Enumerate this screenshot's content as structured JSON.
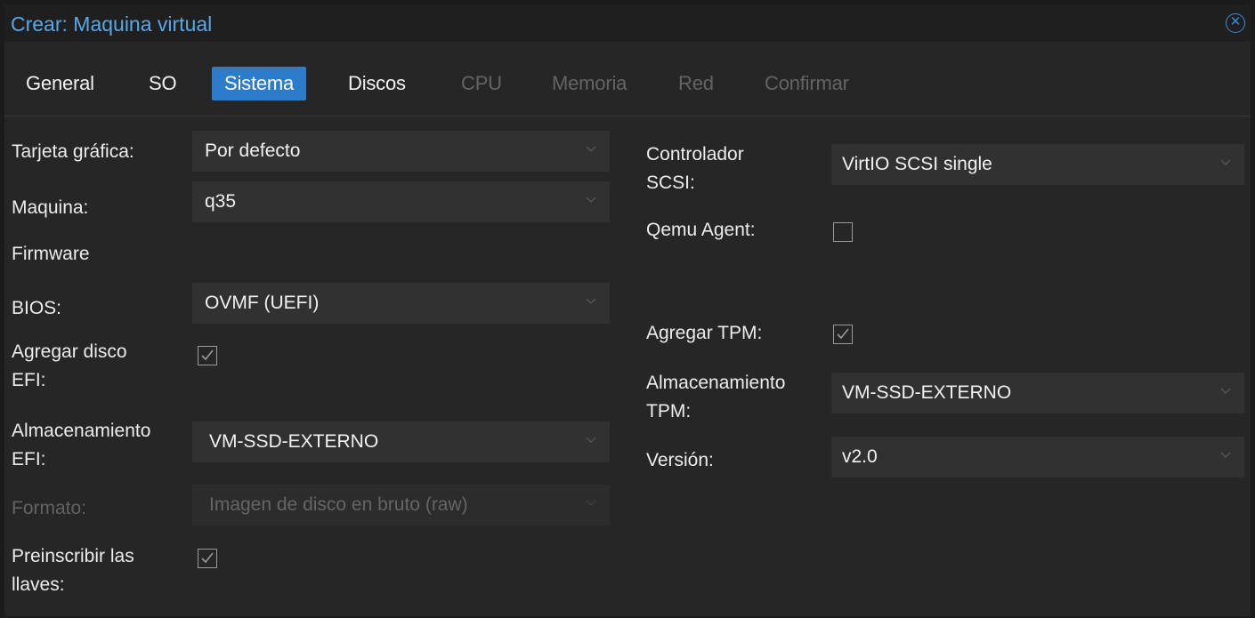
{
  "window": {
    "title": "Crear: Maquina virtual"
  },
  "tabs": [
    {
      "label": "General",
      "state": "normal"
    },
    {
      "label": "SO",
      "state": "normal"
    },
    {
      "label": "Sistema",
      "state": "active"
    },
    {
      "label": "Discos",
      "state": "normal"
    },
    {
      "label": "CPU",
      "state": "disabled"
    },
    {
      "label": "Memoria",
      "state": "disabled"
    },
    {
      "label": "Red",
      "state": "disabled"
    },
    {
      "label": "Confirmar",
      "state": "disabled"
    }
  ],
  "left": {
    "graphics_label": "Tarjeta gráfica:",
    "graphics_value": "Por defecto",
    "machine_label": "Maquina:",
    "machine_value": "q35",
    "firmware_heading": "Firmware",
    "bios_label": "BIOS:",
    "bios_value": "OVMF (UEFI)",
    "efi_disk_label_1": "Agregar disco",
    "efi_disk_label_2": "EFI:",
    "efi_disk_checked": true,
    "efi_storage_label_1": "Almacenamiento",
    "efi_storage_label_2": "EFI:",
    "efi_storage_value": "VM-SSD-EXTERNO",
    "format_label": "Formato:",
    "format_value": "Imagen de disco en bruto (raw)",
    "prekeys_label_1": "Preinscribir las",
    "prekeys_label_2": "llaves:",
    "prekeys_checked": true
  },
  "right": {
    "scsi_label_1": "Controlador",
    "scsi_label_2": "SCSI:",
    "scsi_value": "VirtIO SCSI single",
    "qemu_agent_label": "Qemu Agent:",
    "qemu_agent_checked": false,
    "tpm_label": "Agregar TPM:",
    "tpm_checked": true,
    "tpm_storage_label_1": "Almacenamiento",
    "tpm_storage_label_2": "TPM:",
    "tpm_storage_value": "VM-SSD-EXTERNO",
    "version_label": "Versión:",
    "version_value": "v2.0"
  },
  "colors": {
    "accent": "#2d7cc9",
    "title": "#5aa7e6",
    "background": "#262626",
    "field": "#313131",
    "disabled_text": "#646464"
  }
}
